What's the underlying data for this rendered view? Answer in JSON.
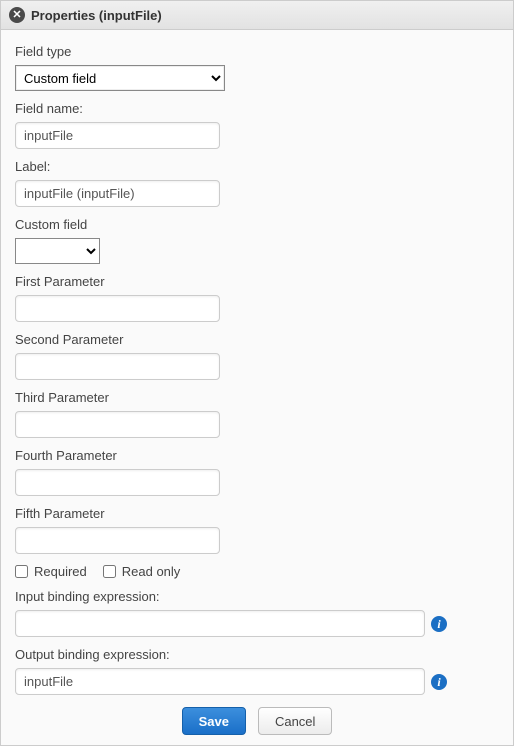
{
  "header": {
    "title": "Properties (inputFile)"
  },
  "fields": {
    "field_type": {
      "label": "Field type",
      "value": "Custom field"
    },
    "field_name": {
      "label": "Field name:",
      "value": "inputFile"
    },
    "label": {
      "label": "Label:",
      "value": "inputFile (inputFile)"
    },
    "custom_field": {
      "label": "Custom field",
      "value": ""
    },
    "first_param": {
      "label": "First Parameter",
      "value": ""
    },
    "second_param": {
      "label": "Second Parameter",
      "value": ""
    },
    "third_param": {
      "label": "Third Parameter",
      "value": ""
    },
    "fourth_param": {
      "label": "Fourth Parameter",
      "value": ""
    },
    "fifth_param": {
      "label": "Fifth Parameter",
      "value": ""
    },
    "required": {
      "label": "Required",
      "checked": false
    },
    "readonly": {
      "label": "Read only",
      "checked": false
    },
    "input_binding": {
      "label": "Input binding expression:",
      "value": ""
    },
    "output_binding": {
      "label": "Output binding expression:",
      "value": "inputFile"
    }
  },
  "buttons": {
    "save": "Save",
    "cancel": "Cancel"
  }
}
